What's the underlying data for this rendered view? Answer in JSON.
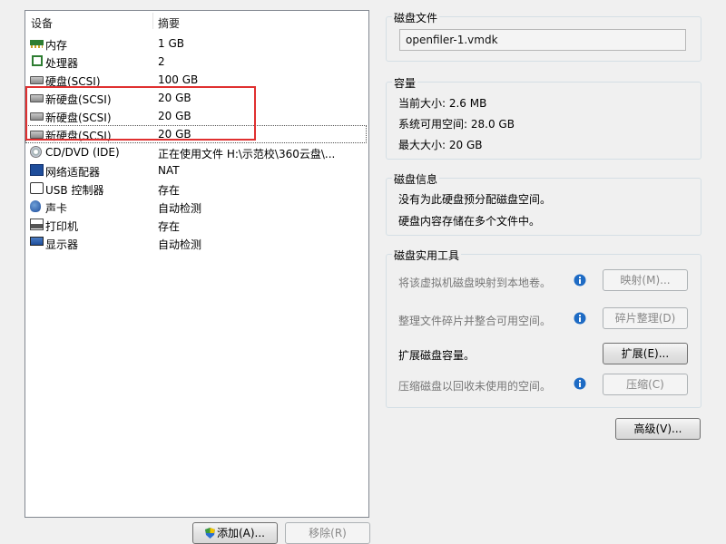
{
  "device_list": {
    "headers": {
      "device": "设备",
      "summary": "摘要"
    },
    "rows": [
      {
        "icon": "memory-icon",
        "device": "内存",
        "summary": "1 GB"
      },
      {
        "icon": "processor-icon",
        "device": "处理器",
        "summary": "2"
      },
      {
        "icon": "hard-disk-icon",
        "device": "硬盘(SCSI)",
        "summary": "100 GB"
      },
      {
        "icon": "hard-disk-icon",
        "device": "新硬盘(SCSI)",
        "summary": "20 GB"
      },
      {
        "icon": "hard-disk-icon",
        "device": "新硬盘(SCSI)",
        "summary": "20 GB"
      },
      {
        "icon": "hard-disk-icon",
        "device": "新硬盘(SCSI)",
        "summary": "20 GB"
      },
      {
        "icon": "cd-dvd-icon",
        "device": "CD/DVD (IDE)",
        "summary": "正在使用文件 H:\\示范校\\360云盘\\..."
      },
      {
        "icon": "network-adapter-icon",
        "device": "网络适配器",
        "summary": "NAT"
      },
      {
        "icon": "usb-icon",
        "device": "USB 控制器",
        "summary": "存在"
      },
      {
        "icon": "sound-card-icon",
        "device": "声卡",
        "summary": "自动检测"
      },
      {
        "icon": "printer-icon",
        "device": "打印机",
        "summary": "存在"
      },
      {
        "icon": "display-icon",
        "device": "显示器",
        "summary": "自动检测"
      }
    ],
    "add_button": "添加(A)...",
    "remove_button": "移除(R)"
  },
  "disk_file": {
    "title": "磁盘文件",
    "value": "openfiler-1.vmdk"
  },
  "capacity": {
    "title": "容量",
    "current": "当前大小: 2.6 MB",
    "available": "系统可用空间: 28.0 GB",
    "max": "最大大小: 20 GB"
  },
  "disk_info": {
    "title": "磁盘信息",
    "line1": "没有为此硬盘预分配磁盘空间。",
    "line2": "硬盘内容存储在多个文件中。"
  },
  "utilities": {
    "title": "磁盘实用工具",
    "map_text": "将该虚拟机磁盘映射到本地卷。",
    "map_button": "映射(M)...",
    "defrag_text": "整理文件碎片并整合可用空间。",
    "defrag_button": "碎片整理(D)",
    "expand_text": "扩展磁盘容量。",
    "expand_button": "扩展(E)...",
    "compact_text": "压缩磁盘以回收未使用的空间。",
    "compact_button": "压缩(C)"
  },
  "advanced_button": "高级(V)...",
  "colors": {
    "highlight": "#e03030",
    "info": "#1e6bc4"
  }
}
